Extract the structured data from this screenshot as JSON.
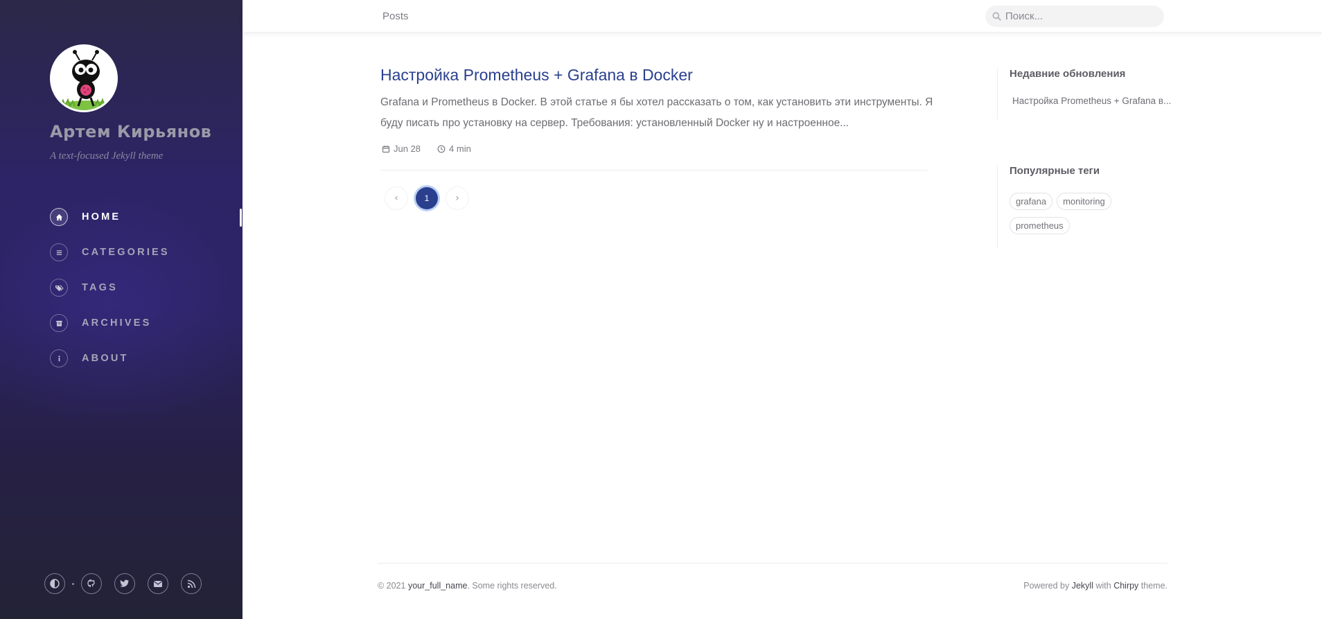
{
  "sidebar": {
    "title": "Артем Кирьянов",
    "subtitle": "A text-focused Jekyll theme",
    "nav": [
      {
        "label": "HOME",
        "icon": "home-icon",
        "active": true
      },
      {
        "label": "CATEGORIES",
        "icon": "list-icon",
        "active": false
      },
      {
        "label": "TAGS",
        "icon": "tags-icon",
        "active": false
      },
      {
        "label": "ARCHIVES",
        "icon": "archive-icon",
        "active": false
      },
      {
        "label": "ABOUT",
        "icon": "info-icon",
        "active": false
      }
    ],
    "bottom_icons": [
      "theme-toggle-icon",
      "github-icon",
      "twitter-icon",
      "email-icon",
      "rss-icon"
    ]
  },
  "topbar": {
    "breadcrumb": "Posts",
    "search_placeholder": "Поиск..."
  },
  "post": {
    "title": "Настройка Prometheus + Grafana в Docker",
    "excerpt": "Grafana и Prometheus в Docker. В этой статье я бы хотел рассказать о том, как установить эти инструменты. Я буду писать про установку на сервер. Требования: установленный Docker ну и настроенное...",
    "date": "Jun 28",
    "read_time": "4 min"
  },
  "pagination": {
    "prev": "‹",
    "current": "1",
    "next": "›"
  },
  "panel": {
    "recent_heading": "Недавние обновления",
    "recent_items": [
      "Настройка Prometheus + Grafana в..."
    ],
    "tags_heading": "Популярные теги",
    "tags": [
      "grafana",
      "monitoring",
      "prometheus"
    ]
  },
  "footer": {
    "copyright_prefix": "© 2021 ",
    "name": "your_full_name",
    "copyright_suffix": ". Some rights reserved.",
    "powered_prefix": "Powered by ",
    "jekyll": "Jekyll",
    "with": " with ",
    "chirpy": "Chirpy",
    "theme_suffix": " theme."
  },
  "colors": {
    "accent": "#2a408e",
    "sidebar_bg": "#2c2466"
  }
}
